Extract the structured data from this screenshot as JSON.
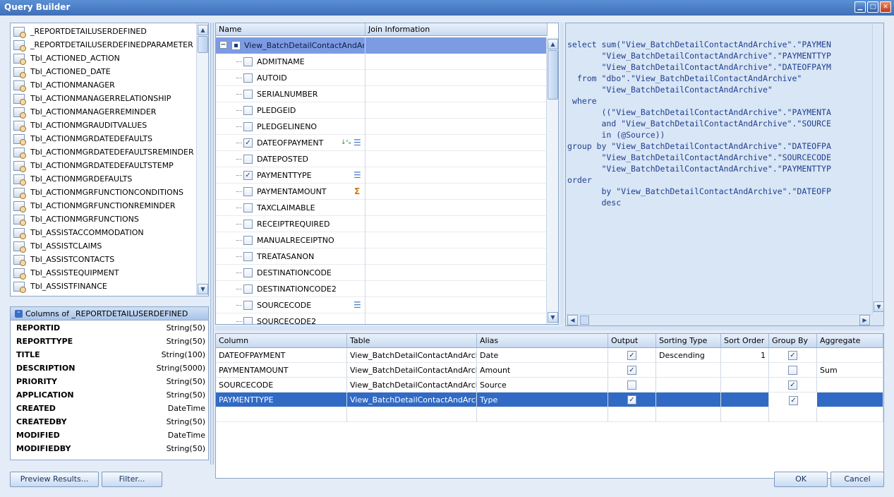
{
  "window": {
    "title": "Query Builder"
  },
  "tables_list": {
    "items": [
      "_REPORTDETAILUSERDEFINED",
      "_REPORTDETAILUSERDEFINEDPARAMETER",
      "Tbl_ACTIONED_ACTION",
      "Tbl_ACTIONED_DATE",
      "Tbl_ACTIONMANAGER",
      "Tbl_ACTIONMANAGERRELATIONSHIP",
      "Tbl_ACTIONMANAGERREMINDER",
      "Tbl_ACTIONMGRAUDITVALUES",
      "Tbl_ACTIONMGRDATEDEFAULTS",
      "Tbl_ACTIONMGRDATEDEFAULTSREMINDER",
      "Tbl_ACTIONMGRDATEDEFAULTSTEMP",
      "Tbl_ACTIONMGRDEFAULTS",
      "Tbl_ACTIONMGRFUNCTIONCONDITIONS",
      "Tbl_ACTIONMGRFUNCTIONREMINDER",
      "Tbl_ACTIONMGRFUNCTIONS",
      "Tbl_ASSISTACCOMMODATION",
      "Tbl_ASSISTCLAIMS",
      "Tbl_ASSISTCONTACTS",
      "Tbl_ASSISTEQUIPMENT",
      "Tbl_ASSISTFINANCE"
    ]
  },
  "columns_panel": {
    "header": "Columns of _REPORTDETAILUSERDEFINED",
    "rows": [
      {
        "name": "REPORTID",
        "type": "String(50)"
      },
      {
        "name": "REPORTTYPE",
        "type": "String(50)"
      },
      {
        "name": "TITLE",
        "type": "String(100)"
      },
      {
        "name": "DESCRIPTION",
        "type": "String(5000)"
      },
      {
        "name": "PRIORITY",
        "type": "String(50)"
      },
      {
        "name": "APPLICATION",
        "type": "String(50)"
      },
      {
        "name": "CREATED",
        "type": "DateTime"
      },
      {
        "name": "CREATEDBY",
        "type": "String(50)"
      },
      {
        "name": "MODIFIED",
        "type": "DateTime"
      },
      {
        "name": "MODIFIEDBY",
        "type": "String(50)"
      }
    ]
  },
  "field_tree": {
    "headers": {
      "name": "Name",
      "join": "Join Information"
    },
    "root": "View_BatchDetailContactAndArchive",
    "fields": [
      {
        "name": "ADMITNAME",
        "checked": false,
        "icon": ""
      },
      {
        "name": "AUTOID",
        "checked": false,
        "icon": ""
      },
      {
        "name": "SERIALNUMBER",
        "checked": false,
        "icon": ""
      },
      {
        "name": "PLEDGEID",
        "checked": false,
        "icon": ""
      },
      {
        "name": "PLEDGELINENO",
        "checked": false,
        "icon": ""
      },
      {
        "name": "DATEOFPAYMENT",
        "checked": true,
        "icon": "sort-desc-group-icon"
      },
      {
        "name": "DATEPOSTED",
        "checked": false,
        "icon": ""
      },
      {
        "name": "PAYMENTTYPE",
        "checked": true,
        "icon": "group-icon"
      },
      {
        "name": "PAYMENTAMOUNT",
        "checked": false,
        "icon": "sum-icon"
      },
      {
        "name": "TAXCLAIMABLE",
        "checked": false,
        "icon": ""
      },
      {
        "name": "RECEIPTREQUIRED",
        "checked": false,
        "icon": ""
      },
      {
        "name": "MANUALRECEIPTNO",
        "checked": false,
        "icon": ""
      },
      {
        "name": "TREATASANON",
        "checked": false,
        "icon": ""
      },
      {
        "name": "DESTINATIONCODE",
        "checked": false,
        "icon": ""
      },
      {
        "name": "DESTINATIONCODE2",
        "checked": false,
        "icon": ""
      },
      {
        "name": "SOURCECODE",
        "checked": false,
        "icon": "group-icon"
      },
      {
        "name": "SOURCECODE2",
        "checked": false,
        "icon": ""
      }
    ]
  },
  "sql": {
    "lines": [
      "select sum(\"View_BatchDetailContactAndArchive\".\"PAYMEN",
      "       \"View_BatchDetailContactAndArchive\".\"PAYMENTTYP",
      "       \"View_BatchDetailContactAndArchive\".\"DATEOFPAYM",
      "  from \"dbo\".\"View_BatchDetailContactAndArchive\"",
      "       \"View_BatchDetailContactAndArchive\"",
      " where",
      "       ((\"View_BatchDetailContactAndArchive\".\"PAYMENTA",
      "       and \"View_BatchDetailContactAndArchive\".\"SOURCE",
      "       in (@Source))",
      "group by \"View_BatchDetailContactAndArchive\".\"DATEOFPA",
      "       \"View_BatchDetailContactAndArchive\".\"SOURCECODE",
      "       \"View_BatchDetailContactAndArchive\".\"PAYMENTTYP",
      "order",
      "       by \"View_BatchDetailContactAndArchive\".\"DATEOFP",
      "       desc"
    ]
  },
  "grid": {
    "headers": [
      "Column",
      "Table",
      "Alias",
      "Output",
      "Sorting Type",
      "Sort Order",
      "Group By",
      "Aggregate"
    ],
    "rows": [
      {
        "column": "DATEOFPAYMENT",
        "table": "View_BatchDetailContactAndArchive",
        "alias": "Date",
        "output": true,
        "sorting": "Descending",
        "order": "1",
        "group": true,
        "aggregate": ""
      },
      {
        "column": "PAYMENTAMOUNT",
        "table": "View_BatchDetailContactAndArchive",
        "alias": "Amount",
        "output": true,
        "sorting": "",
        "order": "",
        "group": false,
        "aggregate": "Sum"
      },
      {
        "column": "SOURCECODE",
        "table": "View_BatchDetailContactAndArchive",
        "alias": "Source",
        "output": false,
        "sorting": "",
        "order": "",
        "group": true,
        "aggregate": ""
      },
      {
        "column": "PAYMENTTYPE",
        "table": "View_BatchDetailContactAndArchive",
        "alias": "Type",
        "output": true,
        "sorting": "",
        "order": "",
        "group": true,
        "aggregate": ""
      }
    ],
    "selected_row": 3
  },
  "buttons": {
    "preview": "Preview Results...",
    "filter": "Filter...",
    "ok": "OK",
    "cancel": "Cancel"
  },
  "colors": {
    "selection": "#316ac5",
    "header_bg": "#c8daf1",
    "sql_text": "#1f3f8f"
  }
}
